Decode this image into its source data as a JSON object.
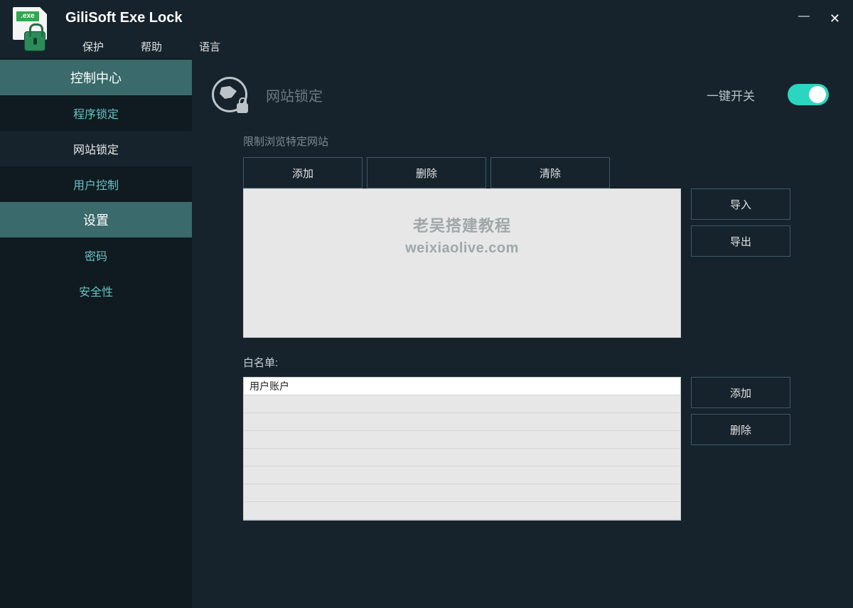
{
  "app": {
    "logo_badge": ".exe",
    "title": "GiliSoft Exe Lock",
    "menu": [
      "保护",
      "帮助",
      "语言"
    ]
  },
  "sidebar": {
    "section_control": "控制中心",
    "items_control": [
      "程序锁定",
      "网站锁定",
      "用户控制"
    ],
    "section_settings": "设置",
    "items_settings": [
      "密码",
      "安全性"
    ],
    "active_index": 1
  },
  "page": {
    "heading": "网站锁定",
    "toggle_label": "一键开关",
    "toggle_on": true
  },
  "restricted": {
    "label": "限制浏览特定网站",
    "buttons": {
      "add": "添加",
      "delete": "删除",
      "clear": "清除"
    },
    "side": {
      "import": "导入",
      "export": "导出"
    },
    "items": []
  },
  "watermark": {
    "line1": "老吴搭建教程",
    "line2": "weixiaolive.com"
  },
  "whitelist": {
    "label": "白名单:",
    "items": [
      "用户账户"
    ],
    "side": {
      "add": "添加",
      "delete": "删除"
    }
  }
}
